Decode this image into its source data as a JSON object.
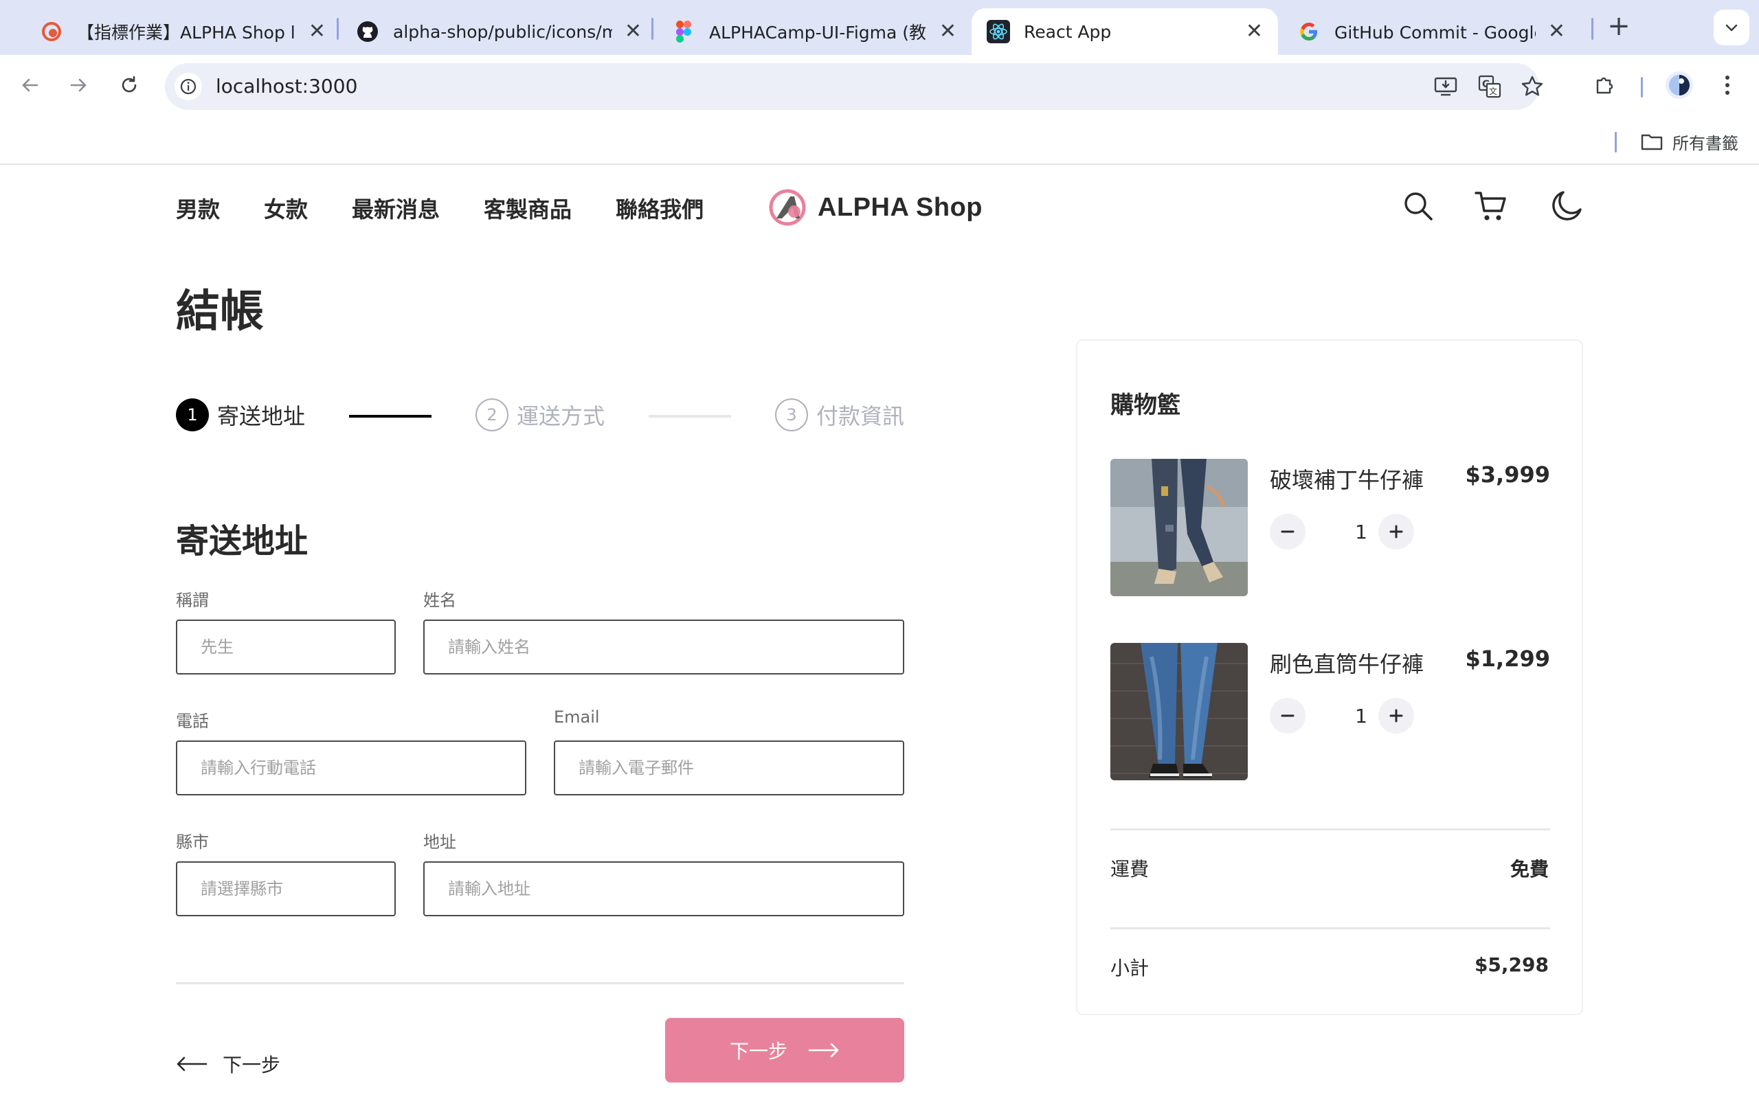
{
  "browser": {
    "tabs": [
      {
        "title": "【指標作業】ALPHA Shop l",
        "icon": "alphacamp-favicon",
        "active": false
      },
      {
        "title": "alpha-shop/public/icons/mi",
        "icon": "github-favicon",
        "active": false
      },
      {
        "title": "ALPHACamp-UI-Figma (教材",
        "icon": "figma-favicon",
        "active": false
      },
      {
        "title": "React App",
        "icon": "react-favicon",
        "active": true
      },
      {
        "title": "GitHub Commit - Google 搜",
        "icon": "google-favicon",
        "active": false
      }
    ],
    "close_glyph": "✕",
    "new_tab_glyph": "+",
    "url": "localhost:3000",
    "bookmarks_folder_label": "所有書籤"
  },
  "header": {
    "nav_links": [
      "男款",
      "女款",
      "最新消息",
      "客製商品",
      "聯絡我們"
    ],
    "brand_name": "ALPHA Shop",
    "icons": [
      "search-icon",
      "cart-icon",
      "moon-icon"
    ]
  },
  "checkout": {
    "title": "結帳",
    "steps": [
      {
        "number": "1",
        "label": "寄送地址",
        "state": "done"
      },
      {
        "number": "2",
        "label": "運送方式",
        "state": "todo"
      },
      {
        "number": "3",
        "label": "付款資訊",
        "state": "todo"
      }
    ],
    "section_title": "寄送地址",
    "fields": {
      "salutation": {
        "label": "稱謂",
        "placeholder": "先生"
      },
      "name": {
        "label": "姓名",
        "placeholder": "請輸入姓名"
      },
      "phone": {
        "label": "電話",
        "placeholder": "請輸入行動電話"
      },
      "email": {
        "label": "Email",
        "placeholder": "請輸入電子郵件"
      },
      "city": {
        "label": "縣市",
        "placeholder": "請選擇縣市"
      },
      "address": {
        "label": "地址",
        "placeholder": "請輸入地址"
      }
    },
    "prev_label": "下一步",
    "next_label": "下一步"
  },
  "cart": {
    "title": "購物籃",
    "items": [
      {
        "name": "破壞補丁牛仔褲",
        "price": "$3,999",
        "quantity": "1"
      },
      {
        "name": "刷色直筒牛仔褲",
        "price": "$1,299",
        "quantity": "1"
      }
    ],
    "shipping_label": "運費",
    "shipping_value": "免費",
    "subtotal_label": "小計",
    "subtotal_value": "$5,298"
  },
  "colors": {
    "accent": "#e8829c",
    "step_done": "#000000",
    "step_todo": "#afb1bd",
    "chrome_tabbar": "#dfe5f7"
  }
}
